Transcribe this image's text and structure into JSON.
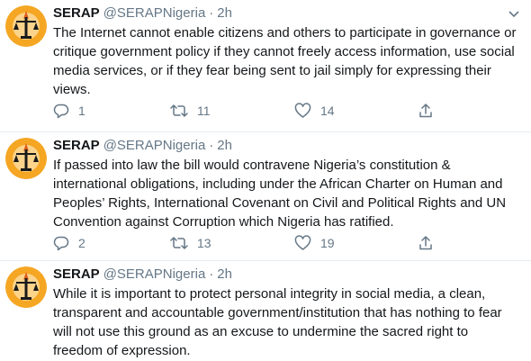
{
  "tweets": [
    {
      "name": "SERAP",
      "handle": "@SERAPNigeria",
      "dot": "·",
      "time": "2h",
      "text": "The Internet cannot enable citizens and others to participate in governance or critique government policy if they cannot freely access information, use social media services, or if they fear being sent to jail simply for expressing their views.",
      "replies": "1",
      "retweets": "11",
      "likes": "14"
    },
    {
      "name": "SERAP",
      "handle": "@SERAPNigeria",
      "dot": "·",
      "time": "2h",
      "text": "If passed into law the bill would contravene Nigeria’s constitution & international obligations, including under the African Charter on Human and Peoples’ Rights, International Covenant on Civil and Political Rights and UN Convention against Corruption which Nigeria has ratified.",
      "replies": "2",
      "retweets": "13",
      "likes": "19"
    },
    {
      "name": "SERAP",
      "handle": "@SERAPNigeria",
      "dot": "·",
      "time": "2h",
      "text": "While it is important to protect personal integrity in social media, a clean, transparent and accountable government/institution that has nothing to fear will not use this ground as an excuse to undermine the sacred right to freedom of expression."
    }
  ],
  "icons": {
    "avatar": "serap-logo-icon",
    "caret": "chevron-down-icon",
    "reply": "reply-icon",
    "retweet": "retweet-icon",
    "like": "heart-icon",
    "share": "share-icon"
  },
  "colors": {
    "text": "#14171a",
    "secondary": "#657786",
    "divider": "#e6ecf0",
    "avatar_orange": "#f5a623",
    "avatar_dark": "#1a1a1a"
  }
}
